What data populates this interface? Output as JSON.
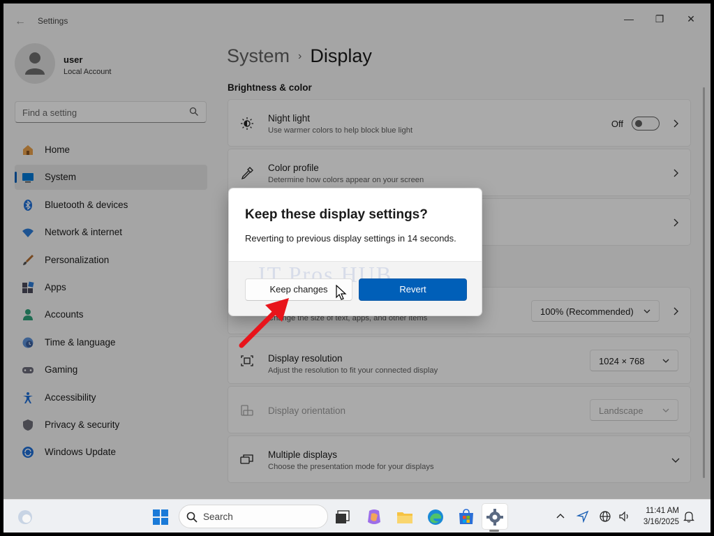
{
  "window": {
    "title": "Settings",
    "back": "←",
    "minimize": "—",
    "maximize": "❐",
    "close": "✕"
  },
  "profile": {
    "name": "user",
    "account_type": "Local Account"
  },
  "search": {
    "placeholder": "Find a setting"
  },
  "nav": {
    "items": [
      {
        "label": "Home",
        "icon": "home-icon"
      },
      {
        "label": "System",
        "icon": "system-icon"
      },
      {
        "label": "Bluetooth & devices",
        "icon": "bluetooth-icon"
      },
      {
        "label": "Network & internet",
        "icon": "wifi-icon"
      },
      {
        "label": "Personalization",
        "icon": "brush-icon"
      },
      {
        "label": "Apps",
        "icon": "apps-icon"
      },
      {
        "label": "Accounts",
        "icon": "accounts-icon"
      },
      {
        "label": "Time & language",
        "icon": "clock-globe-icon"
      },
      {
        "label": "Gaming",
        "icon": "gamepad-icon"
      },
      {
        "label": "Accessibility",
        "icon": "accessibility-icon"
      },
      {
        "label": "Privacy & security",
        "icon": "shield-icon"
      },
      {
        "label": "Windows Update",
        "icon": "update-icon"
      }
    ],
    "active_index": 1
  },
  "breadcrumb": {
    "parent": "System",
    "separator": "›",
    "current": "Display"
  },
  "section": {
    "brightness_color": "Brightness & color"
  },
  "settings": {
    "night_light": {
      "title": "Night light",
      "subtitle": "Use warmer colors to help block blue light",
      "state": "Off"
    },
    "color_profile": {
      "title": "Color profile",
      "subtitle": "Determine how colors appear on your screen"
    },
    "scale": {
      "subtitle": "Change the size of text, apps, and other items",
      "value": "100% (Recommended)"
    },
    "resolution": {
      "title": "Display resolution",
      "subtitle": "Adjust the resolution to fit your connected display",
      "value": "1024 × 768"
    },
    "orientation": {
      "title": "Display orientation",
      "value": "Landscape"
    },
    "multiple": {
      "title": "Multiple displays",
      "subtitle": "Choose the presentation mode for your displays"
    }
  },
  "dialog": {
    "title": "Keep these display settings?",
    "message": "Reverting to previous display settings in 14 seconds.",
    "keep_label": "Keep changes",
    "revert_label": "Revert",
    "watermark": "IT Pros HUB"
  },
  "taskbar": {
    "search_label": "Search",
    "time": "11:41 AM",
    "date": "3/16/2025"
  },
  "colors": {
    "accent": "#005fb8",
    "annotation_arrow": "#e8141b"
  }
}
